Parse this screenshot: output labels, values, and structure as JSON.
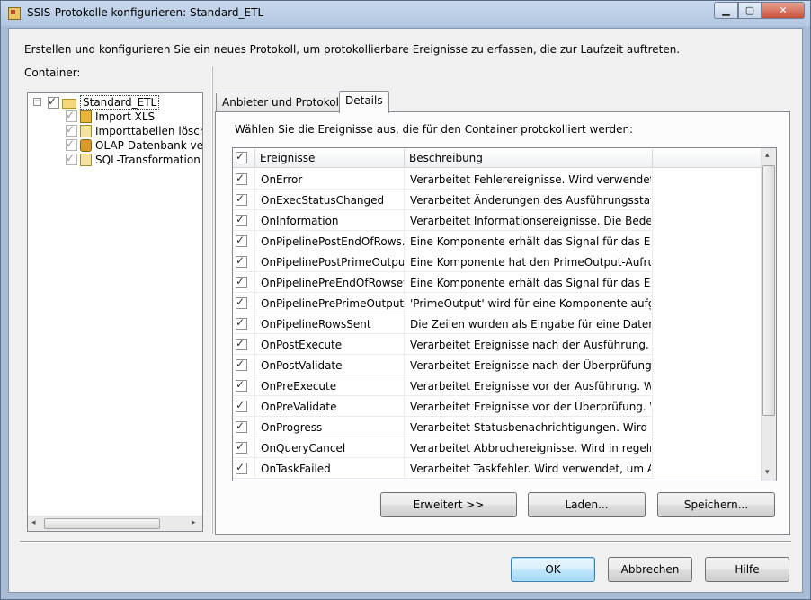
{
  "window": {
    "title": "SSIS-Protokolle konfigurieren: Standard_ETL",
    "buttons": {
      "minimize": "▁",
      "maximize": "▢",
      "close": "✕"
    }
  },
  "intro_text": "Erstellen und konfigurieren Sie ein neues Protokoll, um protokollierbare Ereignisse zu erfassen, die zur Laufzeit auftreten.",
  "container_label": "Container:",
  "tree": {
    "root": {
      "label": "Standard_ETL",
      "expander": "−",
      "check": "✓"
    },
    "children": [
      {
        "label": "Import XLS",
        "check": "✓",
        "icon": "package-icon"
      },
      {
        "label": "Importtabellen lösche",
        "check": "✓",
        "icon": "script-task-icon"
      },
      {
        "label": "OLAP-Datenbank vera",
        "check": "✓",
        "icon": "olap-icon"
      },
      {
        "label": "SQL-Transformation",
        "check": "✓",
        "icon": "script-task-icon"
      }
    ],
    "scroll_left": "◂",
    "scroll_right": "▸"
  },
  "tabs": [
    {
      "label": "Anbieter und Protokolle"
    },
    {
      "label": "Details"
    }
  ],
  "details": {
    "instruction": "Wählen Sie die Ereignisse aus, die für den Container protokolliert werden:",
    "columns": {
      "events": "Ereignisse",
      "description": "Beschreibung"
    },
    "header_check": "✓",
    "rows": [
      {
        "event": "OnError",
        "description": "Verarbeitet Fehlerereignisse. Wird verwendet, u...",
        "check": "✓"
      },
      {
        "event": "OnExecStatusChanged",
        "description": "Verarbeitet Änderungen des Ausführungsstatus....",
        "check": "✓"
      },
      {
        "event": "OnInformation",
        "description": "Verarbeitet Informationsereignisse. Die Bedeutu...",
        "check": "✓"
      },
      {
        "event": "OnPipelinePostEndOfRows...",
        "description": "Eine Komponente erhält das Signal für das Ende...",
        "check": "✓"
      },
      {
        "event": "OnPipelinePostPrimeOutput",
        "description": "Eine Komponente hat den PrimeOutput-Aufruf ...",
        "check": "✓"
      },
      {
        "event": "OnPipelinePreEndOfRowset",
        "description": "Eine Komponente erhält das Signal für das Ende...",
        "check": "✓"
      },
      {
        "event": "OnPipelinePrePrimeOutput",
        "description": "'PrimeOutput' wird für eine Komponente aufge...",
        "check": "✓"
      },
      {
        "event": "OnPipelineRowsSent",
        "description": "Die Zeilen wurden als Eingabe für eine Datenflu...",
        "check": "✓"
      },
      {
        "event": "OnPostExecute",
        "description": "Verarbeitet Ereignisse nach der Ausführung. Wir...",
        "check": "✓"
      },
      {
        "event": "OnPostValidate",
        "description": "Verarbeitet Ereignisse nach der Überprüfung. Wi...",
        "check": "✓"
      },
      {
        "event": "OnPreExecute",
        "description": "Verarbeitet Ereignisse vor der Ausführung. Wird ...",
        "check": "✓"
      },
      {
        "event": "OnPreValidate",
        "description": "Verarbeitet Ereignisse vor der Überprüfung. Wir...",
        "check": "✓"
      },
      {
        "event": "OnProgress",
        "description": "Verarbeitet Statusbenachrichtigungen. Wird ver...",
        "check": "✓"
      },
      {
        "event": "OnQueryCancel",
        "description": "Verarbeitet Abbruchereignisse. Wird in regelmä...",
        "check": "✓"
      },
      {
        "event": "OnTaskFailed",
        "description": "Verarbeitet Taskfehler. Wird verwendet, um Akti...",
        "check": "✓"
      }
    ],
    "scroll_up": "▴",
    "scroll_down": "▾",
    "buttons": {
      "advanced": "Erweitert >>",
      "load": "Laden...",
      "save": "Speichern..."
    }
  },
  "footer": {
    "ok": "OK",
    "cancel": "Abbrechen",
    "help": "Hilfe"
  },
  "colors": {
    "accent": "#3c7fb1",
    "title_bg": "#b3c7e2",
    "dialog_bg": "#f0f0f0"
  }
}
